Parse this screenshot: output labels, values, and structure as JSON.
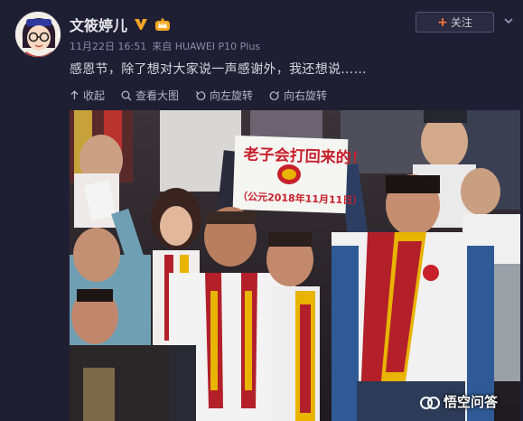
{
  "user": {
    "name": "文筱婷儿",
    "time": "11月22日 16:51",
    "source": "来自 HUAWEI P10 Plus"
  },
  "follow_button": {
    "plus": "+",
    "label": "关注"
  },
  "post": {
    "text": "感恩节，除了想对大家说一声感谢外，我还想说……"
  },
  "toolbar": {
    "collapse": "收起",
    "view_large": "查看大图",
    "rotate_left": "向左旋转",
    "rotate_right": "向右旋转"
  },
  "photo": {
    "sign_line1": "老子会打回来的！",
    "sign_line2": "（公元2018年11月11日）"
  },
  "watermark": {
    "text": "悟空问答"
  },
  "colors": {
    "background": "#1f1f33",
    "follow_plus": "#ff7a33",
    "verified": "#f5a623",
    "scarf_red": "#b3202a",
    "scarf_yellow": "#e8b400"
  }
}
